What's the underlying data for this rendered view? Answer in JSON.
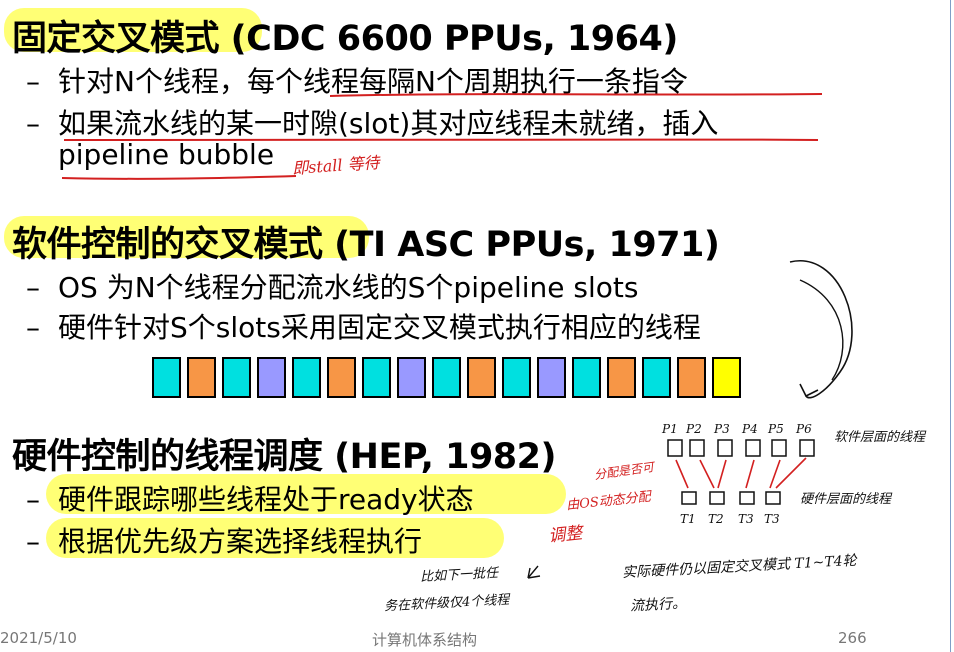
{
  "sections": [
    {
      "heading": "固定交叉模式 (CDC 6600 PPUs, 1964)",
      "bullets": [
        "针对N个线程，每个线程每隔N个周期执行一条指令",
        "如果流水线的某一时隙(slot)其对应线程未就绪，插入",
        "pipeline bubble"
      ]
    },
    {
      "heading": "软件控制的交叉模式 (TI ASC PPUs, 1971)",
      "bullets": [
        "OS 为N个线程分配流水线的S个pipeline slots",
        "硬件针对S个slots采用固定交叉模式执行相应的线程"
      ]
    },
    {
      "heading": "硬件控制的线程调度 (HEP, 1982)",
      "bullets": [
        "硬件跟踪哪些线程处于ready状态",
        "根据优先级方案选择线程执行"
      ]
    }
  ],
  "bullet_dash": "–",
  "slots": [
    {
      "color": "#00e0e0"
    },
    {
      "color": "#f79646"
    },
    {
      "color": "#00e0e0"
    },
    {
      "color": "#9999ff"
    },
    {
      "color": "#00e0e0"
    },
    {
      "color": "#f79646"
    },
    {
      "color": "#00e0e0"
    },
    {
      "color": "#9999ff"
    },
    {
      "color": "#00e0e0"
    },
    {
      "color": "#f79646"
    },
    {
      "color": "#00e0e0"
    },
    {
      "color": "#9999ff"
    },
    {
      "color": "#00e0e0"
    },
    {
      "color": "#f79646"
    },
    {
      "color": "#00e0e0"
    },
    {
      "color": "#f79646"
    },
    {
      "color": "#ffff00"
    }
  ],
  "footer": {
    "date": "2021/5/10",
    "course": "计算机体系结构",
    "page": "266"
  },
  "annotations": {
    "stall": "即stall 等待",
    "os_dynamic": "分配是否可",
    "os_dynamic_2": "由OS动态分配",
    "adjust": "调整",
    "p_labels": [
      "P1",
      "P2",
      "P3",
      "P4",
      "P5",
      "P6"
    ],
    "t_labels": [
      "T1",
      "T2",
      "T3",
      "T3"
    ],
    "software_threads": "软件层面的线程",
    "hardware_threads": "硬件层面的线程",
    "priority_note_1": "比如下一批任",
    "priority_note_2": "务在软件级仅4个线程",
    "fixed_note_1": "实际硬件仍以固定交叉模式 T1~T4轮",
    "fixed_note_2": "流执行。"
  },
  "colors": {
    "highlight": "#ffff66",
    "ink_red": "#d32020"
  }
}
